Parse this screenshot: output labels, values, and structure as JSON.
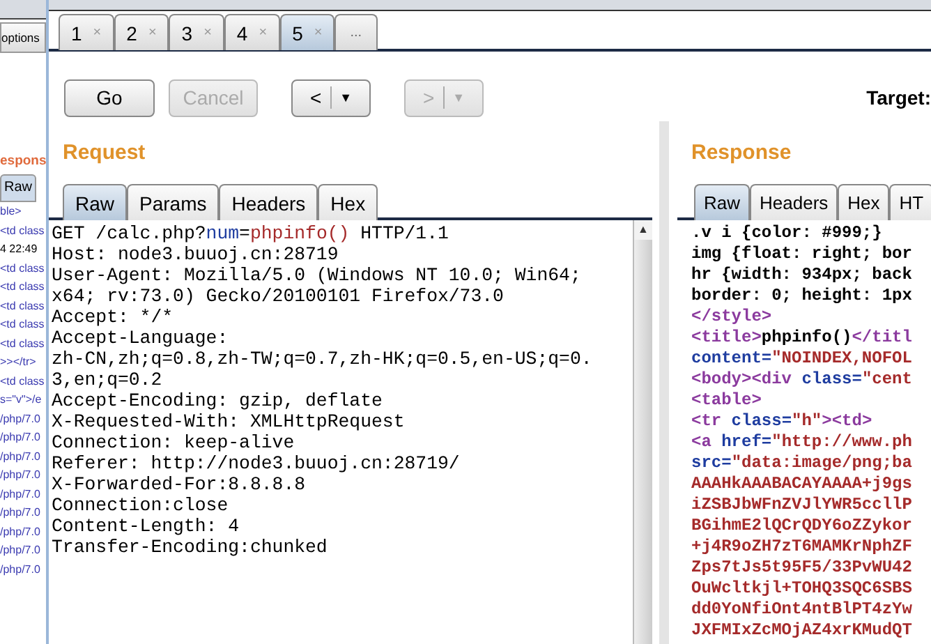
{
  "background_window": {
    "button": "options",
    "heading": "espons",
    "tab": "Raw",
    "lines": [
      "ble>",
      "<td class",
      "4 22:49",
      "<td class",
      "<td class",
      "<td class",
      "<td class",
      "<td class",
      ">></tr>",
      "<td class",
      "s=\"v\">/e",
      "/php/7.0",
      "/php/7.0",
      "/php/7.0",
      "/php/7.0",
      "/php/7.0",
      "/php/7.0",
      "/php/7.0",
      "/php/7.0",
      "/php/7.0"
    ]
  },
  "tabs": [
    {
      "label": "1",
      "close": "×",
      "selected": false
    },
    {
      "label": "2",
      "close": "×",
      "selected": false
    },
    {
      "label": "3",
      "close": "×",
      "selected": false
    },
    {
      "label": "4",
      "close": "×",
      "selected": false
    },
    {
      "label": "5",
      "close": "×",
      "selected": true
    }
  ],
  "more_tabs": "...",
  "toolbar": {
    "go": {
      "label": "Go",
      "disabled": false
    },
    "cancel": {
      "label": "Cancel",
      "disabled": true
    },
    "back": {
      "label": "<",
      "caret": "▼",
      "disabled": false
    },
    "forward": {
      "label": ">",
      "caret": "▼",
      "disabled": true
    }
  },
  "target_label": "Target:",
  "request": {
    "title": "Request",
    "scroll_up": "▲",
    "tabs": [
      {
        "label": "Raw",
        "selected": true
      },
      {
        "label": "Params",
        "selected": false
      },
      {
        "label": "Headers",
        "selected": false
      },
      {
        "label": "Hex",
        "selected": false
      }
    ],
    "lines": [
      [
        {
          "text": "GET /calc.php?",
          "kind": "plain"
        },
        {
          "text": "num",
          "kind": "attr"
        },
        {
          "text": "=",
          "kind": "plain"
        },
        {
          "text": "phpinfo()",
          "kind": "string"
        },
        {
          "text": " HTTP/1.1",
          "kind": "plain"
        }
      ],
      [
        {
          "text": "Host: node3.buuoj.cn:28719",
          "kind": "plain"
        }
      ],
      [
        {
          "text": "User-Agent: Mozilla/5.0 (Windows NT 10.0; Win64;",
          "kind": "plain"
        }
      ],
      [
        {
          "text": "x64; rv:73.0) Gecko/20100101 Firefox/73.0",
          "kind": "plain"
        }
      ],
      [
        {
          "text": "Accept: */*",
          "kind": "plain"
        }
      ],
      [
        {
          "text": "Accept-Language:",
          "kind": "plain"
        }
      ],
      [
        {
          "text": "zh-CN,zh;q=0.8,zh-TW;q=0.7,zh-HK;q=0.5,en-US;q=0.",
          "kind": "plain"
        }
      ],
      [
        {
          "text": "3,en;q=0.2",
          "kind": "plain"
        }
      ],
      [
        {
          "text": "Accept-Encoding: gzip, deflate",
          "kind": "plain"
        }
      ],
      [
        {
          "text": "X-Requested-With: XMLHttpRequest",
          "kind": "plain"
        }
      ],
      [
        {
          "text": "Connection: keep-alive",
          "kind": "plain"
        }
      ],
      [
        {
          "text": "Referer: http://node3.buuoj.cn:28719/",
          "kind": "plain"
        }
      ],
      [
        {
          "text": "X-Forwarded-For:8.8.8.8",
          "kind": "plain"
        }
      ],
      [
        {
          "text": "Connection:close",
          "kind": "plain"
        }
      ],
      [
        {
          "text": "Content-Length: 4",
          "kind": "plain"
        }
      ],
      [
        {
          "text": "Transfer-Encoding:chunked",
          "kind": "plain"
        }
      ]
    ]
  },
  "response": {
    "title": "Response",
    "tabs": [
      {
        "label": "Raw",
        "selected": true
      },
      {
        "label": "Headers",
        "selected": false
      },
      {
        "label": "Hex",
        "selected": false
      },
      {
        "label": "HT",
        "selected": false
      }
    ],
    "lines": [
      [
        {
          "text": ".v i {color: #999;}",
          "kind": "plain"
        }
      ],
      [
        {
          "text": "img {float: right; bor",
          "kind": "plain"
        }
      ],
      [
        {
          "text": "hr {width: 934px; back",
          "kind": "plain"
        }
      ],
      [
        {
          "text": "border: 0; height: 1px",
          "kind": "plain"
        }
      ],
      [
        {
          "text": "</style>",
          "kind": "tag"
        }
      ],
      [
        {
          "text": "<title>",
          "kind": "tag"
        },
        {
          "text": "phpinfo()",
          "kind": "plain"
        },
        {
          "text": "</titl",
          "kind": "tag"
        }
      ],
      [
        {
          "text": "content=",
          "kind": "attr"
        },
        {
          "text": "\"NOINDEX,NOFOL",
          "kind": "string"
        }
      ],
      [
        {
          "text": "<body><div",
          "kind": "tag"
        },
        {
          "text": " class=",
          "kind": "attr"
        },
        {
          "text": "\"cent",
          "kind": "string"
        }
      ],
      [
        {
          "text": "<table>",
          "kind": "tag"
        }
      ],
      [
        {
          "text": "<tr",
          "kind": "tag"
        },
        {
          "text": " class=",
          "kind": "attr"
        },
        {
          "text": "\"h\"",
          "kind": "string"
        },
        {
          "text": "><td>",
          "kind": "tag"
        }
      ],
      [
        {
          "text": "<a",
          "kind": "tag"
        },
        {
          "text": " href=",
          "kind": "attr"
        },
        {
          "text": "\"http://www.ph",
          "kind": "string"
        }
      ],
      [
        {
          "text": "src=",
          "kind": "attr"
        },
        {
          "text": "\"data:image/png;ba",
          "kind": "string"
        }
      ],
      [
        {
          "text": "AAAHkAAABACAYAAAA+j9gs",
          "kind": "string"
        }
      ],
      [
        {
          "text": "iZSBJbWFnZVJlYWR5ccllP",
          "kind": "string"
        }
      ],
      [
        {
          "text": "BGihmE2lQCrQDY6oZZykor",
          "kind": "string"
        }
      ],
      [
        {
          "text": "+j4R9oZH7zT6MAMKrNphZF",
          "kind": "string"
        }
      ],
      [
        {
          "text": "Zps7tJs5t95F5/33PvWU42",
          "kind": "string"
        }
      ],
      [
        {
          "text": "OuWcltkjl+TOHQ3SQC6SBS",
          "kind": "string"
        }
      ],
      [
        {
          "text": "dd0YoNfiOnt4ntBlPT4zYw",
          "kind": "string"
        }
      ],
      [
        {
          "text": "JXFMIxZcMOjAZ4xrKMudQT",
          "kind": "string"
        }
      ]
    ]
  }
}
